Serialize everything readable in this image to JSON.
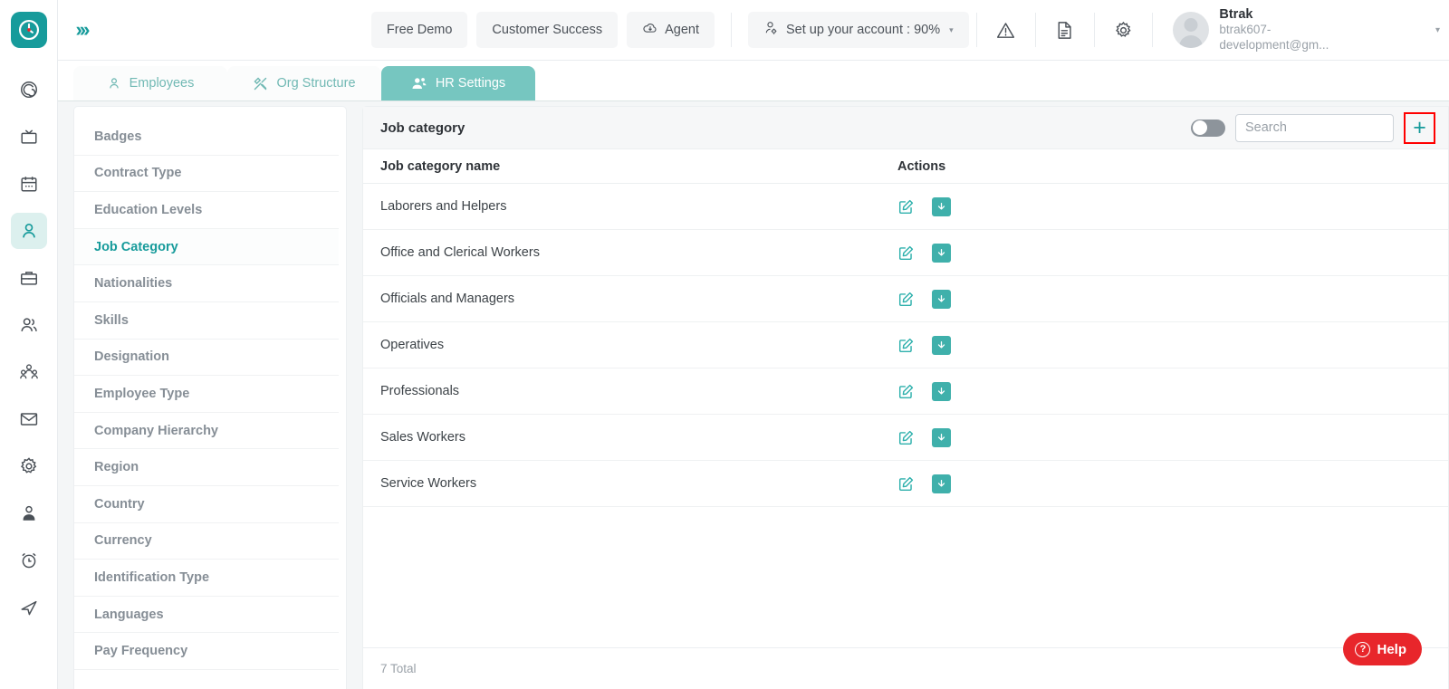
{
  "brand": {
    "accent": "#179b9b",
    "tab_active_bg": "#76c6c0",
    "danger": "#e8262b",
    "highlight": "#ff0000"
  },
  "topbar": {
    "expand_label": "›››",
    "buttons": [
      {
        "label": "Free Demo",
        "icon": ""
      },
      {
        "label": "Customer Success",
        "icon": ""
      },
      {
        "label": "Agent",
        "icon": "cloud-download-icon"
      },
      {
        "label": "Set up your account : 90%",
        "icon": "user-gear-icon",
        "caret": "▾"
      }
    ],
    "icons": [
      {
        "name": "warning-triangle-icon"
      },
      {
        "name": "document-icon"
      },
      {
        "name": "gear-icon"
      }
    ],
    "profile": {
      "name": "Btrak",
      "email": "btrak607-development@gm...",
      "caret": "▾"
    }
  },
  "tabs": [
    {
      "label": "Employees",
      "icon": "user-icon",
      "active": false
    },
    {
      "label": "Org Structure",
      "icon": "tools-icon",
      "active": false
    },
    {
      "label": "HR Settings",
      "icon": "users-gear-icon",
      "active": true
    }
  ],
  "rail": {
    "logo_icon": "clock-logo-icon",
    "items": [
      {
        "name": "target-icon",
        "active": false
      },
      {
        "name": "tv-icon",
        "active": false
      },
      {
        "name": "calendar-icon",
        "active": false
      },
      {
        "name": "employee-icon",
        "active": true
      },
      {
        "name": "briefcase-icon",
        "active": false
      },
      {
        "name": "people-icon",
        "active": false
      },
      {
        "name": "team-icon",
        "active": false
      },
      {
        "name": "mail-icon",
        "active": false
      },
      {
        "name": "settings-gear-icon",
        "active": false
      },
      {
        "name": "profile-icon",
        "active": false
      },
      {
        "name": "alarm-clock-icon",
        "active": false
      },
      {
        "name": "send-icon",
        "active": false
      }
    ]
  },
  "settings_menu": {
    "items": [
      {
        "label": "Badges",
        "active": false
      },
      {
        "label": "Contract Type",
        "active": false
      },
      {
        "label": "Education Levels",
        "active": false
      },
      {
        "label": "Job Category",
        "active": true
      },
      {
        "label": "Nationalities",
        "active": false
      },
      {
        "label": "Skills",
        "active": false
      },
      {
        "label": "Designation",
        "active": false
      },
      {
        "label": "Employee Type",
        "active": false
      },
      {
        "label": "Company Hierarchy",
        "active": false
      },
      {
        "label": "Region",
        "active": false
      },
      {
        "label": "Country",
        "active": false
      },
      {
        "label": "Currency",
        "active": false
      },
      {
        "label": "Identification Type",
        "active": false
      },
      {
        "label": "Languages",
        "active": false
      },
      {
        "label": "Pay Frequency",
        "active": false
      }
    ]
  },
  "panel": {
    "title": "Job category",
    "toggle_state": "off",
    "search_placeholder": "Search",
    "search_value": "",
    "add_label": "+",
    "columns": {
      "name": "Job category name",
      "actions": "Actions"
    },
    "rows": [
      {
        "name": "Laborers and Helpers"
      },
      {
        "name": "Office and Clerical Workers"
      },
      {
        "name": "Officials and Managers"
      },
      {
        "name": "Operatives"
      },
      {
        "name": "Professionals"
      },
      {
        "name": "Sales Workers"
      },
      {
        "name": "Service Workers"
      }
    ],
    "row_actions": {
      "edit": "edit-icon",
      "archive": "archive-icon"
    },
    "total_text": "7 Total"
  },
  "help": {
    "label": "Help",
    "glyph": "?"
  }
}
